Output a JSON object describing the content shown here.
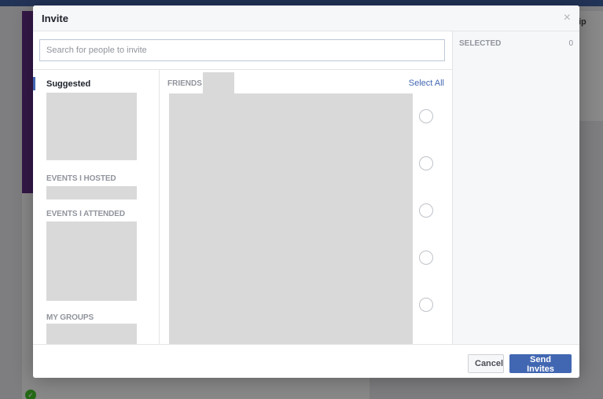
{
  "dialog": {
    "title": "Invite",
    "close_icon": "×"
  },
  "search": {
    "placeholder": "Search for people to invite"
  },
  "sidebar": {
    "active_item": "Suggested",
    "sections": [
      "EVENTS I HOSTED",
      "EVENTS I ATTENDED",
      "MY GROUPS"
    ]
  },
  "friends": {
    "label": "FRIENDS",
    "select_all": "Select All"
  },
  "selected": {
    "label": "SELECTED",
    "count": "0"
  },
  "footer": {
    "cancel": "Cancel",
    "send": "Send Invites"
  },
  "background": {
    "tab_fragment": "ip"
  },
  "colors": {
    "accent": "#4267b2",
    "header_bg": "#f6f7f9"
  }
}
